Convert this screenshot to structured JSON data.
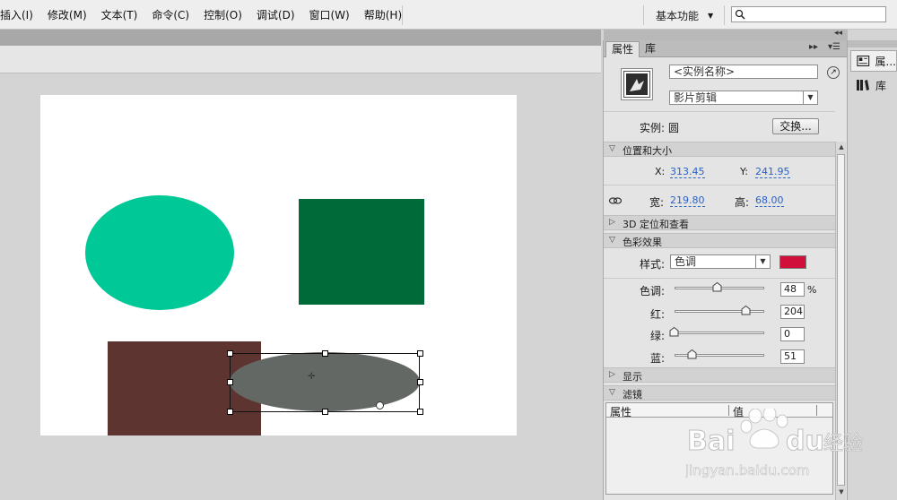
{
  "menu": {
    "items": [
      "插入(I)",
      "修改(M)",
      "文本(T)",
      "命令(C)",
      "控制(O)",
      "调试(D)",
      "窗口(W)",
      "帮助(H)"
    ],
    "workspace_label": "基本功能",
    "search_placeholder": ""
  },
  "panel": {
    "tabs": {
      "properties": "属性",
      "library": "库"
    },
    "instance_name_placeholder": "<实例名称>",
    "symbol_type": "影片剪辑",
    "instance_label": "实例:",
    "instance_value": "圆",
    "swap_button": "交换...",
    "sections": {
      "position_size": "位置和大小",
      "position_3d": "3D 定位和查看",
      "color_effect": "色彩效果",
      "display": "显示",
      "filters": "滤镜"
    },
    "x_label": "X:",
    "x_value": "313.45",
    "y_label": "Y:",
    "y_value": "241.95",
    "width_label": "宽:",
    "width_value": "219.80",
    "height_label": "高:",
    "height_value": "68.00",
    "style_label": "样式:",
    "style_value": "色调",
    "tint_color": "#d0103a",
    "tint_label": "色调:",
    "tint_value": "48",
    "tint_unit": "%",
    "red_label": "红:",
    "red_value": "204",
    "green_label": "绿:",
    "green_value": "0",
    "blue_label": "蓝:",
    "blue_value": "51",
    "slider_levels": {
      "tint": 0.48,
      "red": 0.8,
      "green": 0.0,
      "blue": 0.2
    },
    "filter_table": {
      "col_property": "属性",
      "col_value": "值"
    }
  },
  "dock": {
    "properties_label": "属...",
    "library_label": "库"
  },
  "stage": {
    "colors": {
      "teal_ellipse": "#00c896",
      "green_square": "#006b38",
      "brown_square": "#5e3430",
      "grey_ellipse": "#636864"
    }
  },
  "watermark": {
    "brand": "Bai du 经验",
    "url": "jingyan.baidu.com"
  }
}
